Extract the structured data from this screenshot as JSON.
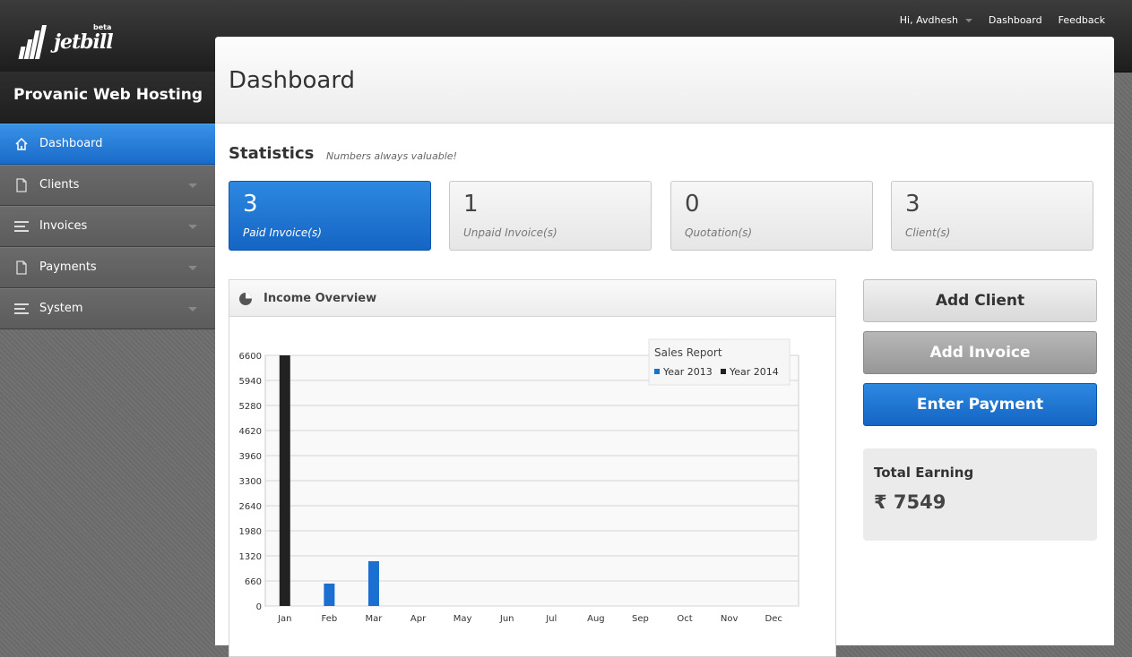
{
  "brand": {
    "name": "jetbill",
    "badge": "beta"
  },
  "topnav": {
    "greeting": "Hi, Avdhesh",
    "dashboard": "Dashboard",
    "feedback": "Feedback"
  },
  "sidebar": {
    "company": "Provanic Web Hosting",
    "items": [
      {
        "label": "Dashboard",
        "icon": "home-icon",
        "active": true
      },
      {
        "label": "Clients",
        "icon": "document-icon"
      },
      {
        "label": "Invoices",
        "icon": "list-icon"
      },
      {
        "label": "Payments",
        "icon": "document-icon"
      },
      {
        "label": "System",
        "icon": "list-icon"
      }
    ]
  },
  "page": {
    "title": "Dashboard"
  },
  "statistics": {
    "title": "Statistics",
    "subtitle": "Numbers always valuable!",
    "boxes": [
      {
        "value": "3",
        "label": "Paid Invoice(s)"
      },
      {
        "value": "1",
        "label": "Unpaid Invoice(s)"
      },
      {
        "value": "0",
        "label": "Quotation(s)"
      },
      {
        "value": "3",
        "label": "Client(s)"
      }
    ]
  },
  "panel": {
    "title": "Income Overview"
  },
  "actions": {
    "add_client": "Add Client",
    "add_invoice": "Add Invoice",
    "enter_payment": "Enter Payment"
  },
  "earning": {
    "title": "Total Earning",
    "value": "₹ 7549"
  },
  "colors": {
    "accent": "#1a6fd0",
    "year2014": "#222222"
  },
  "chart_data": {
    "type": "bar",
    "legend_title": "Sales Report",
    "legend_position": "top-right",
    "categories": [
      "Jan",
      "Feb",
      "Mar",
      "Apr",
      "May",
      "Jun",
      "Jul",
      "Aug",
      "Sep",
      "Oct",
      "Nov",
      "Dec"
    ],
    "series": [
      {
        "name": "Year 2013",
        "color": "#1a6fd0",
        "values": [
          0,
          590,
          1180,
          0,
          0,
          0,
          0,
          0,
          0,
          0,
          0,
          0
        ]
      },
      {
        "name": "Year 2014",
        "color": "#222222",
        "values": [
          6600,
          0,
          0,
          0,
          0,
          0,
          0,
          0,
          0,
          0,
          0,
          0
        ]
      }
    ],
    "yticks": [
      0,
      660,
      1320,
      1980,
      2640,
      3300,
      3960,
      4620,
      5280,
      5940,
      6600
    ],
    "ylim": [
      0,
      6600
    ],
    "grid": true
  }
}
